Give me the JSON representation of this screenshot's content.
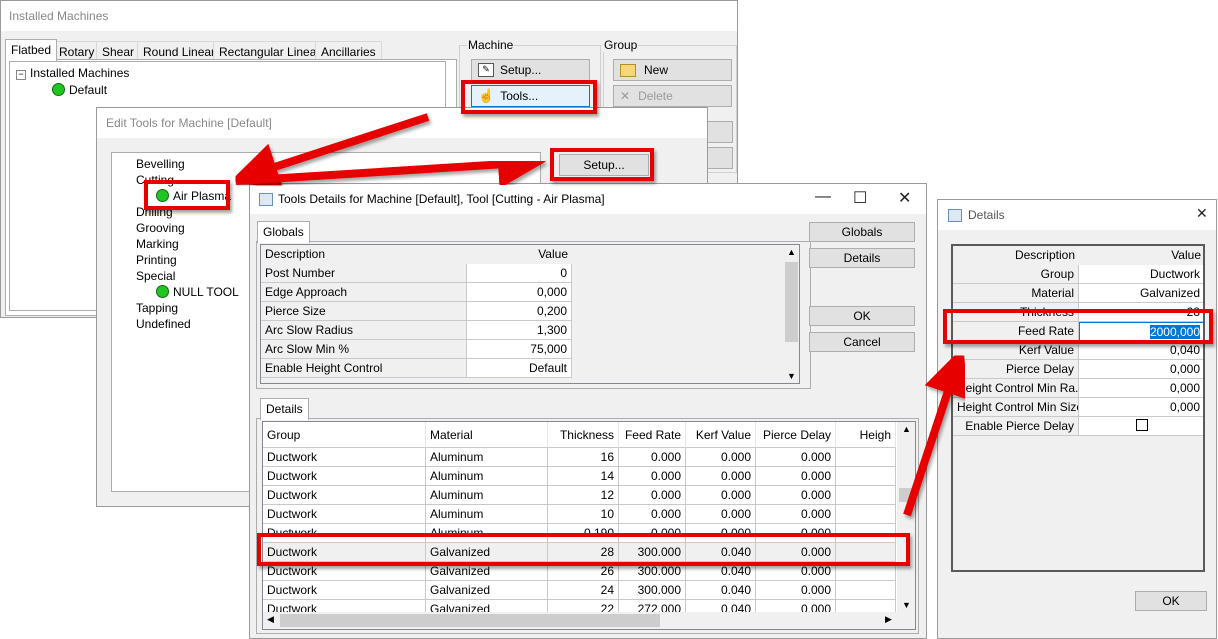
{
  "installed": {
    "title": "Installed Machines",
    "tabs": [
      "Flatbed",
      "Rotary",
      "Shear",
      "Round Linear",
      "Rectangular Linear",
      "Ancillaries"
    ],
    "tree": {
      "root": "Installed Machines",
      "child": "Default"
    },
    "machine_group_label": "Machine",
    "group_group_label": "Group",
    "setup_label": "Setup...",
    "tools_label": "Tools...",
    "new_label": "New",
    "delete_label": "Delete"
  },
  "edit_tools": {
    "title": "Edit Tools for Machine [Default]",
    "setup_label": "Setup...",
    "tree": [
      "Bevelling",
      "Cutting",
      "Air Plasma",
      "Drilling",
      "Grooving",
      "Marking",
      "Printing",
      "Special",
      "NULL TOOL",
      "Tapping",
      "Undefined"
    ]
  },
  "tools_details": {
    "title": "Tools Details for Machine [Default], Tool [Cutting - Air Plasma]",
    "globals_tab": "Globals",
    "globals_header": {
      "description": "Description",
      "value": "Value"
    },
    "globals_rows": [
      {
        "description": "Post Number",
        "value": "0"
      },
      {
        "description": "Edge Approach",
        "value": "0,000"
      },
      {
        "description": "Pierce Size",
        "value": "0,200"
      },
      {
        "description": "Arc Slow Radius",
        "value": "1,300"
      },
      {
        "description": "Arc Slow Min %",
        "value": "75,000"
      },
      {
        "description": "Enable Height Control",
        "value": "Default"
      }
    ],
    "details_tab": "Details",
    "details_columns": [
      "Group",
      "Material",
      "Thickness",
      "Feed Rate",
      "Kerf Value",
      "Pierce Delay",
      "Heigh"
    ],
    "details_rows": [
      [
        "Ductwork",
        "Aluminum",
        "16",
        "0.000",
        "0.000",
        "0.000"
      ],
      [
        "Ductwork",
        "Aluminum",
        "14",
        "0.000",
        "0.000",
        "0.000"
      ],
      [
        "Ductwork",
        "Aluminum",
        "12",
        "0.000",
        "0.000",
        "0.000"
      ],
      [
        "Ductwork",
        "Aluminum",
        "10",
        "0.000",
        "0.000",
        "0.000"
      ],
      [
        "Ductwork",
        "Aluminum",
        "0.190",
        "0.000",
        "0.000",
        "0.000"
      ],
      [
        "Ductwork",
        "Galvanized",
        "28",
        "300.000",
        "0.040",
        "0.000"
      ],
      [
        "Ductwork",
        "Galvanized",
        "26",
        "300.000",
        "0.040",
        "0.000"
      ],
      [
        "Ductwork",
        "Galvanized",
        "24",
        "300.000",
        "0.040",
        "0.000"
      ],
      [
        "Ductwork",
        "Galvanized",
        "22",
        "272.000",
        "0.040",
        "0.000"
      ]
    ],
    "buttons": {
      "globals": "Globals",
      "details": "Details",
      "ok": "OK",
      "cancel": "Cancel"
    }
  },
  "details_dialog": {
    "title": "Details",
    "header": {
      "description": "Description",
      "value": "Value"
    },
    "rows": [
      {
        "description": "Group",
        "value": "Ductwork"
      },
      {
        "description": "Material",
        "value": "Galvanized"
      },
      {
        "description": "Thickness",
        "value": "28"
      },
      {
        "description": "Feed Rate",
        "value": "2000,000"
      },
      {
        "description": "Kerf Value",
        "value": "0,040"
      },
      {
        "description": "Pierce Delay",
        "value": "0,000"
      },
      {
        "description": "Height Control Min Ra...",
        "value": "0,000"
      },
      {
        "description": "Height Control Min Size",
        "value": "0,000"
      },
      {
        "description": "Enable Pierce Delay",
        "value": ""
      }
    ],
    "ok_label": "OK"
  },
  "colors": {
    "highlight": "#e60000",
    "selection": "#0078d7",
    "status_green": "#21c521"
  }
}
